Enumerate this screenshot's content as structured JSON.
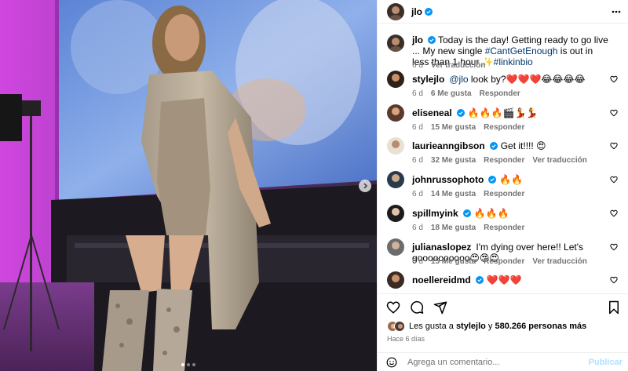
{
  "author": {
    "username": "jlo",
    "verified": true
  },
  "caption": {
    "username": "jlo",
    "text_before": "Today is the day! Getting ready to go live ... My new single ",
    "hashtag1": "#CantGetEnough",
    "text_middle": " is out in less than 1 hour ✨",
    "hashtag2": "#linkinbio",
    "time": "6 d",
    "translate": "Ver traducción"
  },
  "comments": [
    {
      "username": "stylejlo",
      "verified": false,
      "mention": "@jlo",
      "text": " look by?❤️❤️❤️😂😂😂😂",
      "time": "6 d",
      "likes": "6 Me gusta",
      "reply": "Responder",
      "translate": ""
    },
    {
      "username": "eliseneal",
      "verified": true,
      "mention": "",
      "text": "🔥🔥🔥🎬💃💃",
      "time": "6 d",
      "likes": "15 Me gusta",
      "reply": "Responder",
      "translate": ""
    },
    {
      "username": "laurieanngibson",
      "verified": true,
      "mention": "",
      "text": "Get it!!!! 😍",
      "time": "6 d",
      "likes": "32 Me gusta",
      "reply": "Responder",
      "translate": "Ver traducción"
    },
    {
      "username": "johnrussophoto",
      "verified": true,
      "mention": "",
      "text": "🔥🔥",
      "time": "6 d",
      "likes": "14 Me gusta",
      "reply": "Responder",
      "translate": ""
    },
    {
      "username": "spillmyink",
      "verified": true,
      "mention": "",
      "text": "🔥🔥🔥",
      "time": "6 d",
      "likes": "18 Me gusta",
      "reply": "Responder",
      "translate": ""
    },
    {
      "username": "julianaslopez",
      "verified": false,
      "mention": "",
      "text": "I'm dying over here!! Let's goooooooooo😍😍😍",
      "time": "6 d",
      "likes": "15 Me gusta",
      "reply": "Responder",
      "translate": "Ver traducción"
    },
    {
      "username": "noellereidmd",
      "verified": true,
      "mention": "",
      "text": "❤️❤️❤️",
      "time": "",
      "likes": "",
      "reply": "",
      "translate": ""
    }
  ],
  "likes": {
    "prefix": "Les gusta a ",
    "user": "stylejlo",
    "middle": " y ",
    "count": "580.266 personas más"
  },
  "posted": "Hace 6 días",
  "comment_box": {
    "placeholder": "Agrega un comentario...",
    "publish": "Publicar"
  },
  "carousel": {
    "count": 3,
    "active": 1
  },
  "colors": {
    "link": "#00376b",
    "verified": "#0095f6",
    "meta": "#737373",
    "publish_disabled": "#b2dffc"
  },
  "icons": [
    "more-icon",
    "heart-icon",
    "comment-icon",
    "share-icon",
    "bookmark-icon",
    "emoji-icon",
    "chevron-right-icon",
    "verified-icon"
  ]
}
